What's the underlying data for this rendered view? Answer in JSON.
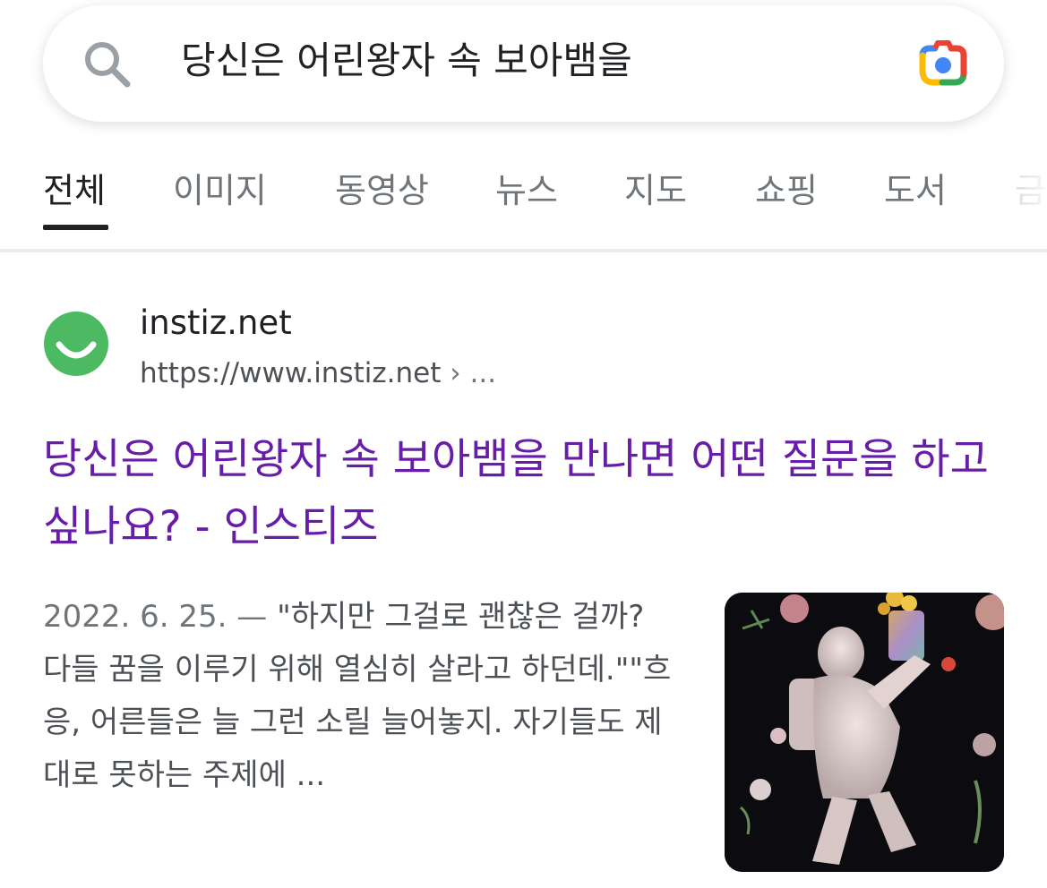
{
  "search": {
    "query": "당신은 어린왕자 속 보아뱀을"
  },
  "tabs": [
    {
      "label": "전체",
      "active": true
    },
    {
      "label": "이미지",
      "active": false
    },
    {
      "label": "동영상",
      "active": false
    },
    {
      "label": "뉴스",
      "active": false
    },
    {
      "label": "지도",
      "active": false
    },
    {
      "label": "쇼핑",
      "active": false
    },
    {
      "label": "도서",
      "active": false
    },
    {
      "label": "금",
      "active": false
    }
  ],
  "result": {
    "site_name": "instiz.net",
    "url": "https://www.instiz.net",
    "url_suffix": "› ...",
    "title": "당신은 어린왕자 속 보아뱀을 만나면 어떤 질문을 하고 싶나요? - 인스티즈",
    "date": "2022. 6. 25. —",
    "snippet": " \"하지만 그걸로 괜찮은 걸까? 다들 꿈을 이루기 위해 열심히 살라고 하던데.\"\"흐응, 어른들은 늘 그런 소릴 늘어놓지. 자기들도 제대로 못하는 주제에 ..."
  },
  "colors": {
    "visited_link": "#681da8",
    "favicon_green": "#4cb963",
    "text_primary": "#202124",
    "text_secondary": "#4d5156",
    "tab_inactive": "#70757a"
  },
  "icons": {
    "search": "search-icon",
    "lens": "google-lens-icon",
    "favicon": "smiley-favicon-icon"
  }
}
